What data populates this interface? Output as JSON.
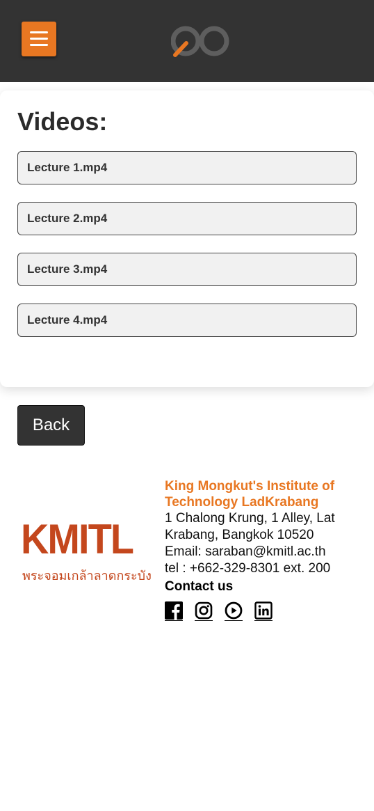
{
  "header": {
    "menu_icon": "hamburger-menu-icon",
    "logo_icon": "infinity-logo-icon",
    "accent_color": "#e87722",
    "bar_color": "#333333"
  },
  "videos": {
    "heading": "Videos:",
    "items": [
      {
        "label": "Lecture 1.mp4"
      },
      {
        "label": "Lecture 2.mp4"
      },
      {
        "label": "Lecture 3.mp4"
      },
      {
        "label": "Lecture 4.mp4"
      }
    ]
  },
  "back_label": "Back",
  "footer": {
    "logo_text": "KMITL",
    "logo_thai": "พระจอมเกล้าลาดกระบัง",
    "logo_color": "#c4471d",
    "org_name": "King Mongkut's Institute of Technology LadKrabang",
    "address": "1 Chalong Krung, 1 Alley, Lat Krabang, Bangkok 10520",
    "email": "Email: saraban@kmitl.ac.th",
    "tel": "tel : +662-329-8301 ext. 200",
    "contact_heading": "Contact us",
    "social_icons": [
      "facebook-icon",
      "instagram-icon",
      "youtube-icon",
      "linkedin-icon"
    ]
  }
}
